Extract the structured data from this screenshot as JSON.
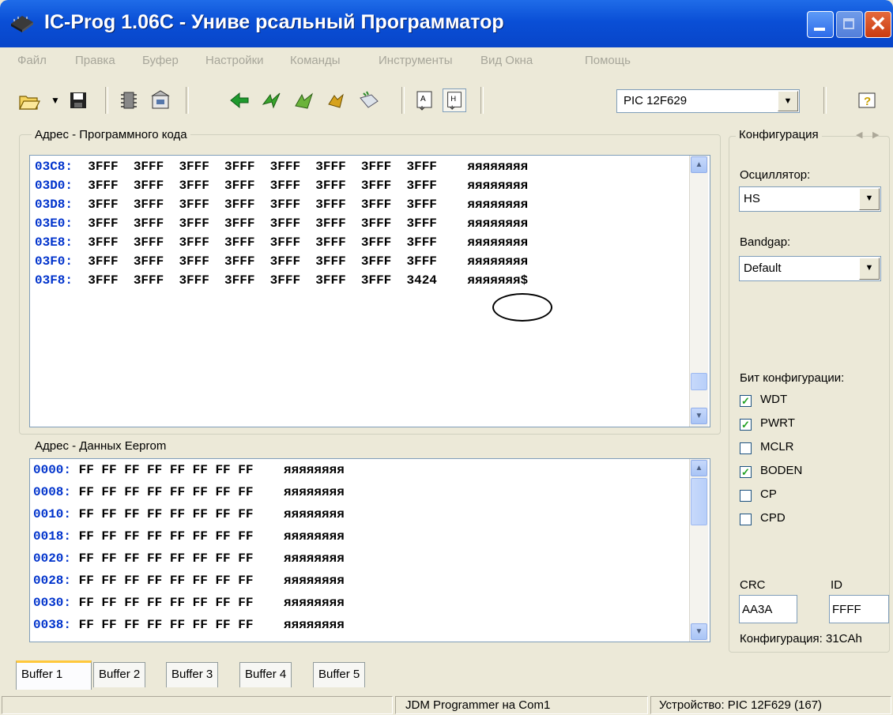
{
  "window": {
    "title": "IC-Prog 1.06C - Униве рсальный Программатор",
    "close_glyph": "✕"
  },
  "menu": [
    "Файл",
    "Правка",
    "Буфер",
    "Настройки",
    "Команды",
    "Инструменты",
    "Вид Окна",
    "Помощь"
  ],
  "toolbar": {
    "device": "PIC 12F629",
    "dropdown_glyph": "▼"
  },
  "program_section": {
    "label": "Адрес - Программного кода",
    "rows": [
      {
        "addr": "03C8:",
        "data": "3FFF  3FFF  3FFF  3FFF  3FFF  3FFF  3FFF  3FFF",
        "ascii": "яяяяяяяя"
      },
      {
        "addr": "03D0:",
        "data": "3FFF  3FFF  3FFF  3FFF  3FFF  3FFF  3FFF  3FFF",
        "ascii": "яяяяяяяя"
      },
      {
        "addr": "03D8:",
        "data": "3FFF  3FFF  3FFF  3FFF  3FFF  3FFF  3FFF  3FFF",
        "ascii": "яяяяяяяя"
      },
      {
        "addr": "03E0:",
        "data": "3FFF  3FFF  3FFF  3FFF  3FFF  3FFF  3FFF  3FFF",
        "ascii": "яяяяяяяя"
      },
      {
        "addr": "03E8:",
        "data": "3FFF  3FFF  3FFF  3FFF  3FFF  3FFF  3FFF  3FFF",
        "ascii": "яяяяяяяя"
      },
      {
        "addr": "03F0:",
        "data": "3FFF  3FFF  3FFF  3FFF  3FFF  3FFF  3FFF  3FFF",
        "ascii": "яяяяяяяя"
      },
      {
        "addr": "03F8:",
        "data": "3FFF  3FFF  3FFF  3FFF  3FFF  3FFF  3FFF  3424",
        "ascii": "яяяяяяя$"
      }
    ]
  },
  "eeprom_section": {
    "label": "Адрес - Данных Eeprom",
    "rows": [
      {
        "addr": "0000:",
        "data": "FF FF FF FF FF FF FF FF",
        "ascii": "яяяяяяяя"
      },
      {
        "addr": "0008:",
        "data": "FF FF FF FF FF FF FF FF",
        "ascii": "яяяяяяяя"
      },
      {
        "addr": "0010:",
        "data": "FF FF FF FF FF FF FF FF",
        "ascii": "яяяяяяяя"
      },
      {
        "addr": "0018:",
        "data": "FF FF FF FF FF FF FF FF",
        "ascii": "яяяяяяяя"
      },
      {
        "addr": "0020:",
        "data": "FF FF FF FF FF FF FF FF",
        "ascii": "яяяяяяяя"
      },
      {
        "addr": "0028:",
        "data": "FF FF FF FF FF FF FF FF",
        "ascii": "яяяяяяяя"
      },
      {
        "addr": "0030:",
        "data": "FF FF FF FF FF FF FF FF",
        "ascii": "яяяяяяяя"
      },
      {
        "addr": "0038:",
        "data": "FF FF FF FF FF FF FF FF",
        "ascii": "яяяяяяяя"
      }
    ]
  },
  "config": {
    "title": "Конфигурация",
    "oscillator_label": "Осциллятор:",
    "oscillator_value": "HS",
    "bandgap_label": "Bandgap:",
    "bandgap_value": "Default",
    "bits_label": "Бит конфигурации:",
    "bits": [
      {
        "name": "WDT",
        "checked": true
      },
      {
        "name": "PWRT",
        "checked": true
      },
      {
        "name": "MCLR",
        "checked": false
      },
      {
        "name": "BODEN",
        "checked": true
      },
      {
        "name": "CP",
        "checked": false
      },
      {
        "name": "CPD",
        "checked": false
      }
    ],
    "crc_label": "CRC",
    "crc_value": "AA3A",
    "id_label": "ID",
    "id_value": "FFFF",
    "config_word": "Конфигурация: 31CAh"
  },
  "tabs": [
    "Buffer 1",
    "Buffer 2",
    "Buffer 3",
    "Buffer 4",
    "Buffer 5"
  ],
  "status": {
    "programmer": "JDM Programmer на Com1",
    "device": "Устройство: PIC 12F629  (167)"
  }
}
